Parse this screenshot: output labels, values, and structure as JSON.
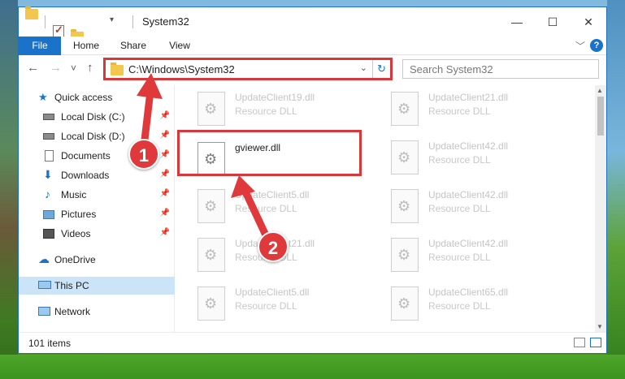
{
  "window": {
    "title": "System32",
    "minimize": "—",
    "maximize": "☐",
    "close": "✕"
  },
  "ribbon": {
    "tabs": [
      "File",
      "Home",
      "Share",
      "View"
    ],
    "expand_icon": "﹀",
    "help": "?"
  },
  "nav": {
    "back": "←",
    "forward": "→",
    "recent": "˅",
    "up": "↑",
    "address": "C:\\Windows\\System32",
    "refresh": "↻",
    "search_placeholder": "Search System32"
  },
  "sidebar": {
    "items": [
      {
        "label": "Quick access",
        "icon": "star-icon"
      },
      {
        "label": "Local Disk (C:)",
        "icon": "drive-icon",
        "pinned": true
      },
      {
        "label": "Local Disk (D:)",
        "icon": "drive-icon",
        "pinned": true
      },
      {
        "label": "Documents",
        "icon": "documents-icon",
        "pinned": true
      },
      {
        "label": "Downloads",
        "icon": "download-icon",
        "pinned": true
      },
      {
        "label": "Music",
        "icon": "music-icon",
        "pinned": true
      },
      {
        "label": "Pictures",
        "icon": "pictures-icon",
        "pinned": true
      },
      {
        "label": "Videos",
        "icon": "videos-icon",
        "pinned": true
      },
      {
        "label": "OneDrive",
        "icon": "cloud-icon"
      },
      {
        "label": "This PC",
        "icon": "computer-icon",
        "selected": true
      },
      {
        "label": "Network",
        "icon": "network-icon"
      }
    ]
  },
  "files": {
    "left": [
      {
        "name": "UpdateClient19.dll",
        "type": "Resource DLL"
      },
      {
        "name": "gviewer.dll",
        "type": ""
      },
      {
        "name": "UpdateClient5.dll",
        "type": "Resource DLL"
      },
      {
        "name": "UpdateClient21.dll",
        "type": "Resource DLL"
      },
      {
        "name": "UpdateClient5.dll",
        "type": "Resource DLL"
      }
    ],
    "right": [
      {
        "name": "UpdateClient21.dll",
        "type": "Resource DLL"
      },
      {
        "name": "UpdateClient42.dll",
        "type": "Resource DLL"
      },
      {
        "name": "UpdateClient42.dll",
        "type": "Resource DLL"
      },
      {
        "name": "UpdateClient42.dll",
        "type": "Resource DLL"
      },
      {
        "name": "UpdateClient65.dll",
        "type": "Resource DLL"
      }
    ]
  },
  "status": {
    "item_count": "101 items"
  },
  "annotations": {
    "step1": "1",
    "step2": "2",
    "color": "#e0393b"
  }
}
